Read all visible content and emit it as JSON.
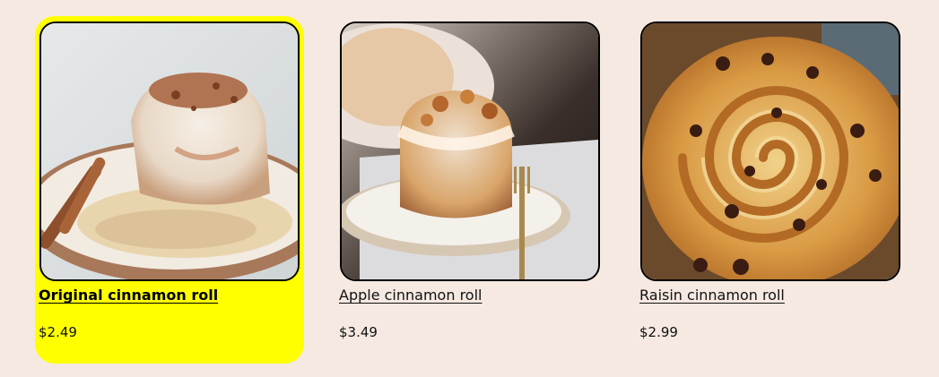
{
  "products": [
    {
      "name": "Original cinnamon roll",
      "price": "$2.49",
      "selected": true
    },
    {
      "name": "Apple cinnamon roll",
      "price": "$3.49",
      "selected": false
    },
    {
      "name": "Raisin cinnamon roll",
      "price": "$2.99",
      "selected": false
    }
  ],
  "colors": {
    "page_background": "#f5e9e1",
    "selected_highlight": "#ffff00"
  }
}
